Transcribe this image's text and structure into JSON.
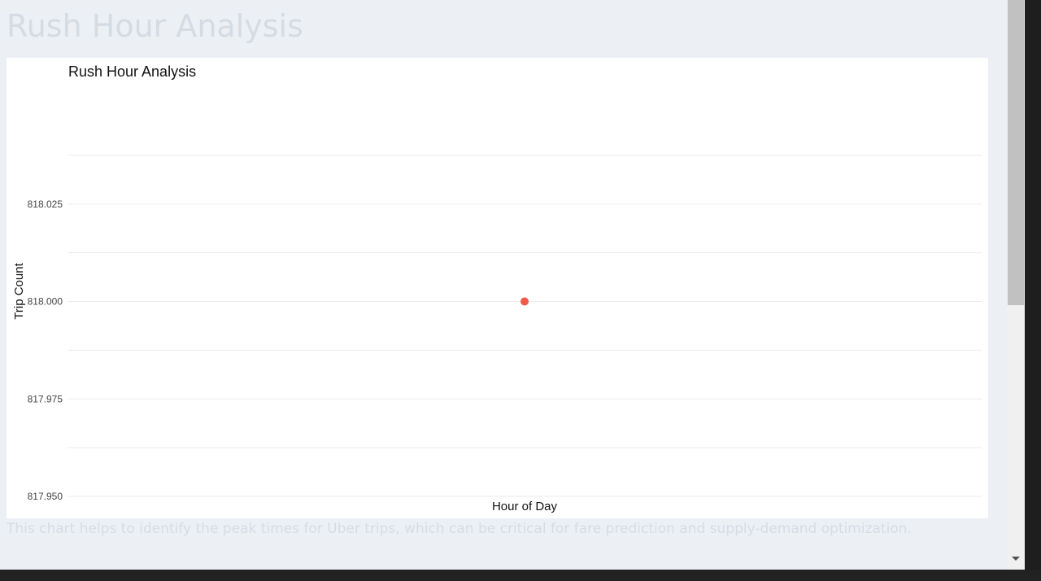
{
  "page": {
    "heading": "Rush Hour Analysis",
    "caption": "This chart helps to identify the peak times for Uber trips, which can be critical for fare prediction and supply-demand optimization."
  },
  "chart_data": {
    "type": "scatter",
    "title": "Rush Hour Analysis",
    "xlabel": "Hour of Day",
    "ylabel": "Trip Count",
    "ylim": [
      817.95,
      818.05
    ],
    "y_ticks": [
      817.95,
      817.975,
      818.0,
      818.025
    ],
    "y_tick_labels": [
      "817.950",
      "817.975",
      "818.000",
      "818.025"
    ],
    "x_ticks": [],
    "grid": true,
    "points": [
      {
        "x": null,
        "y": 818.0
      }
    ],
    "marker_color": "#ef5a4a",
    "gridline_color": "#ebebeb"
  }
}
